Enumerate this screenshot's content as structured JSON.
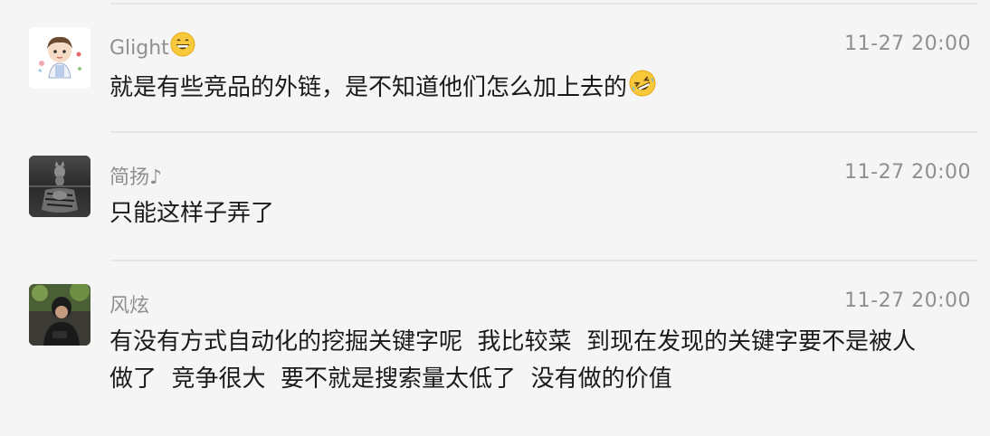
{
  "messages": [
    {
      "sender": "Glight",
      "sender_emoji": "grinning-face-emoji",
      "time": "11-27 20:00",
      "text": "就是有些竞品的外链，是不知道他们怎么加上去的",
      "text_emoji": "rolling-on-floor-laughing-emoji"
    },
    {
      "sender": "简扬♪",
      "time": "11-27 20:00",
      "text": "只能这样子弄了"
    },
    {
      "sender": "风炫",
      "time": "11-27 20:00",
      "text_line1": "有没有方式自动化的挖掘关键字呢  我比较菜  到现在发现的关键字要不是被人",
      "text_line2": "做了  竞争很大  要不就是搜索量太低了  没有做的价值"
    }
  ],
  "colors": {
    "background": "#f5f5f5",
    "meta_text": "#8f8f8f",
    "body_text": "#1a1a1a",
    "divider": "#e6e6e6"
  }
}
